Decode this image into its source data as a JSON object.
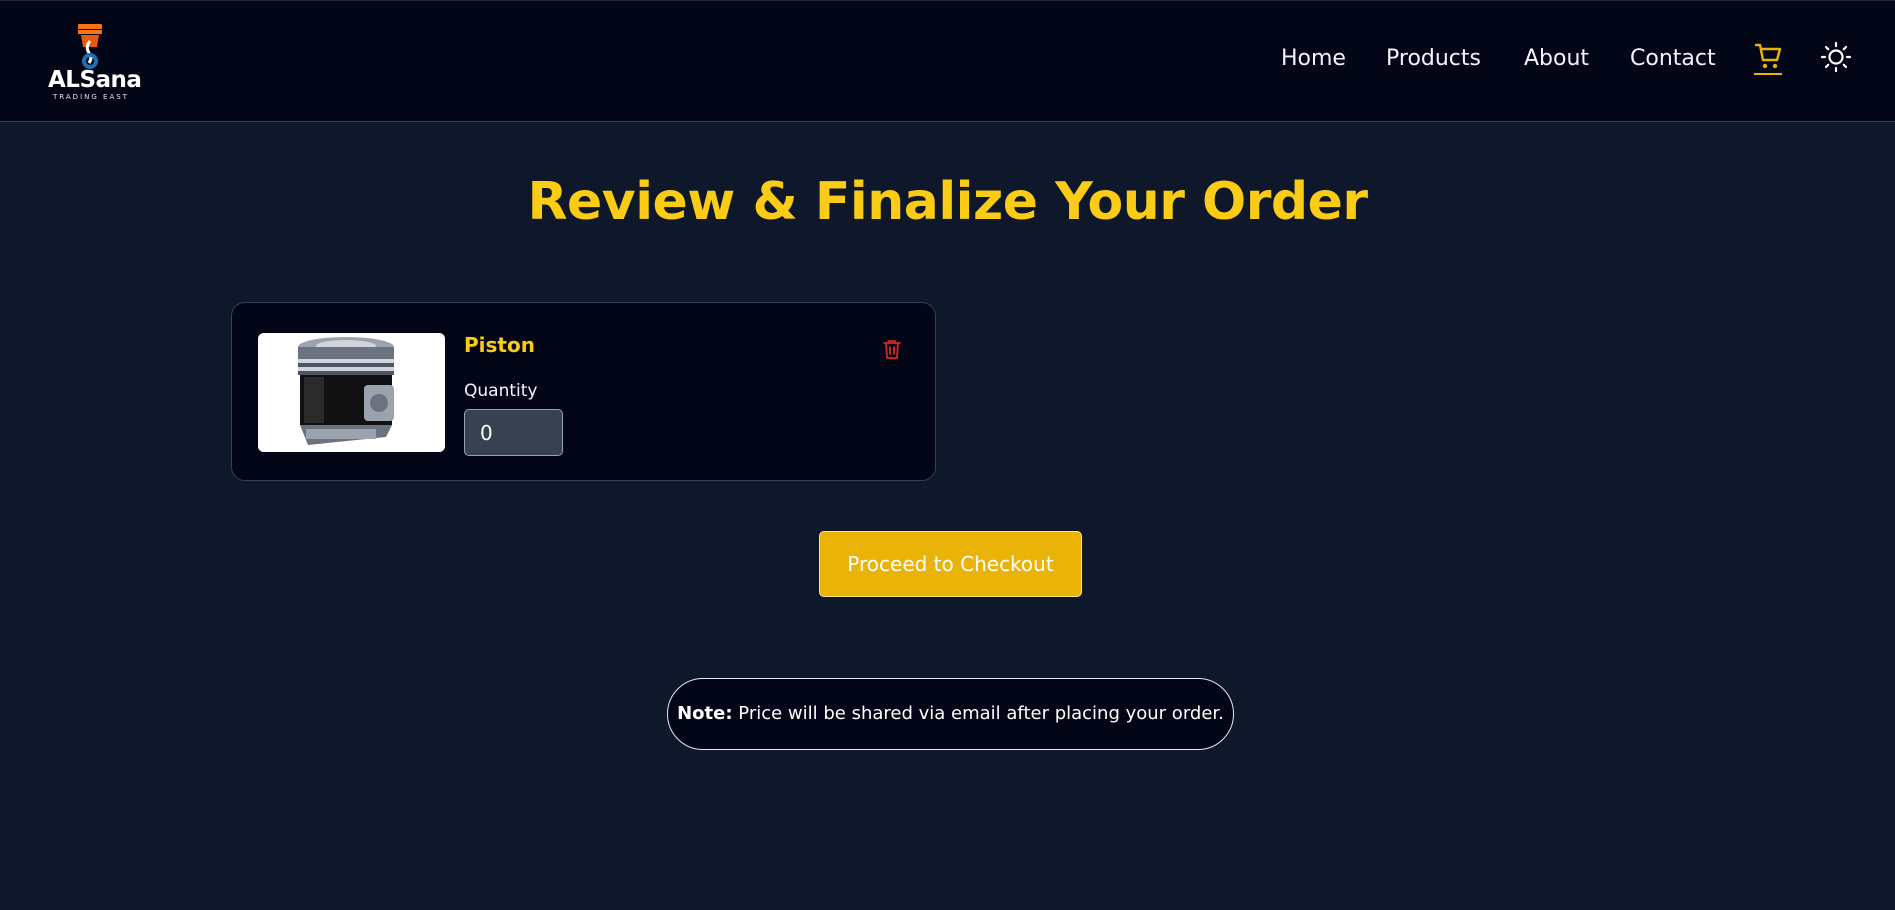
{
  "header": {
    "logo": {
      "title": "ALSana",
      "subtitle": "TRADING EAST"
    },
    "nav": [
      {
        "label": "Home"
      },
      {
        "label": "Products"
      },
      {
        "label": "About"
      },
      {
        "label": "Contact"
      }
    ],
    "cart_icon": "cart-icon",
    "theme_icon": "sun-icon"
  },
  "main": {
    "title": "Review & Finalize Your Order",
    "cart_items": [
      {
        "name": "Piston",
        "quantity_label": "Quantity",
        "quantity_value": "0",
        "delete_icon": "trash-icon"
      }
    ],
    "checkout_label": "Proceed to Checkout",
    "note": {
      "label": "Note:",
      "text": " Price will be shared via email after placing your order."
    }
  },
  "colors": {
    "background": "#0f172a",
    "header_bg": "#020617",
    "accent": "#facc15",
    "button": "#eab308",
    "danger": "#dc2626"
  }
}
